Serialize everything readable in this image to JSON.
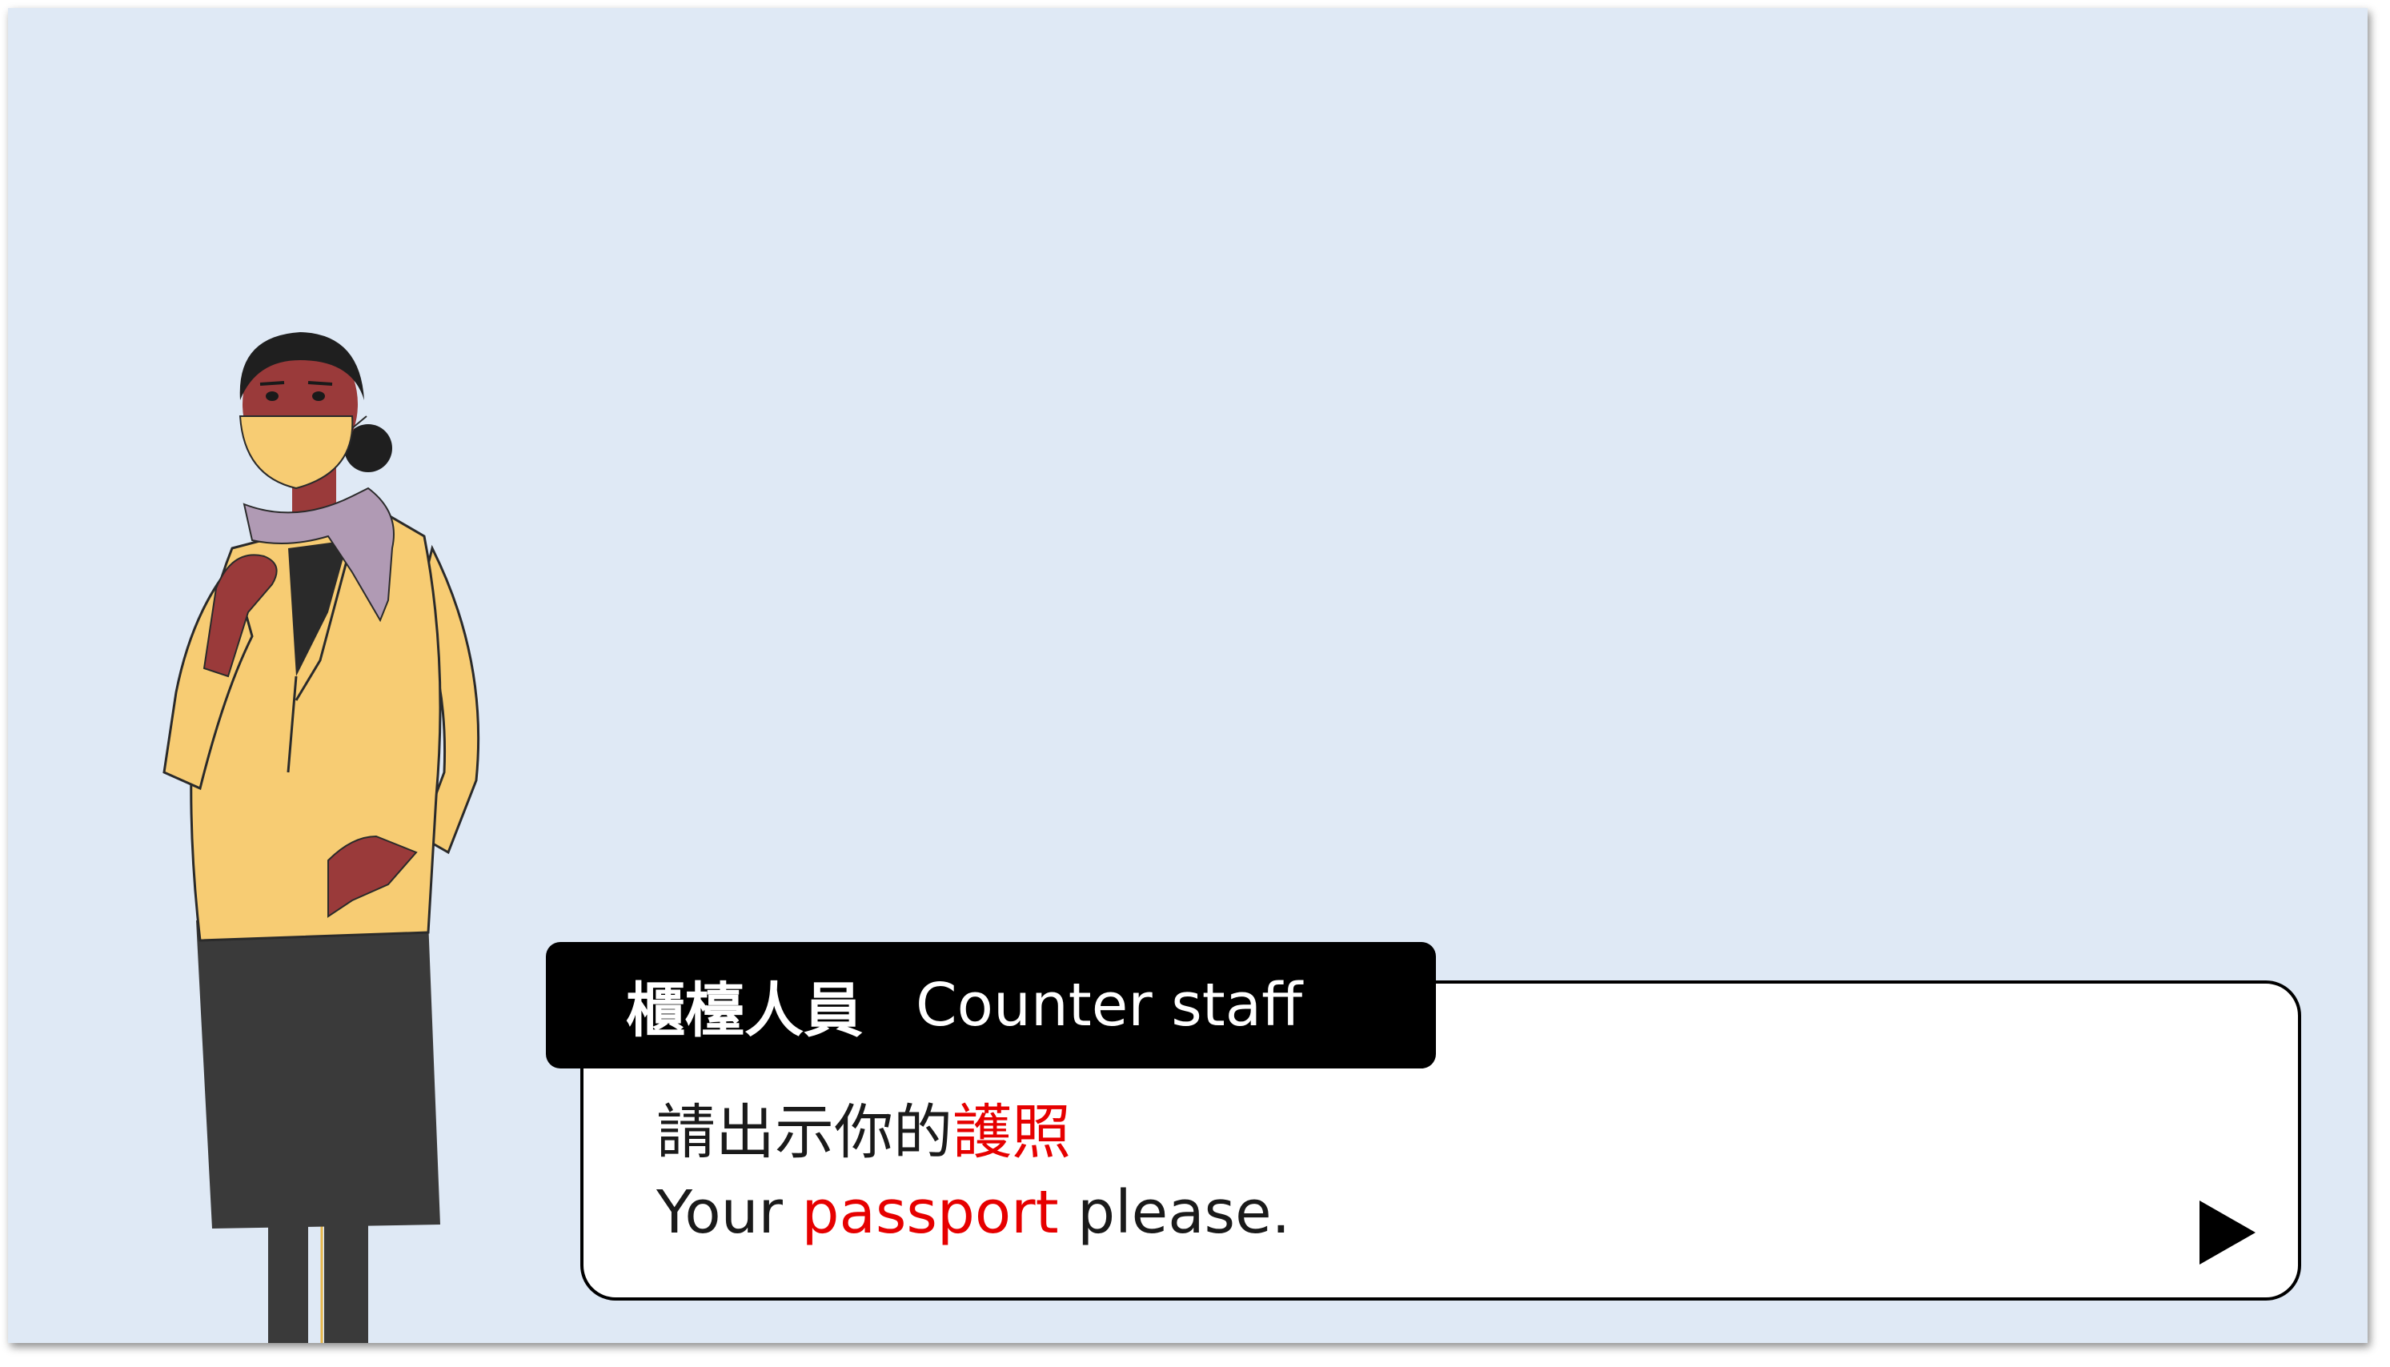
{
  "speaker": {
    "name_zh": "櫃檯人員",
    "name_en": "Counter staff"
  },
  "dialog": {
    "line_zh": {
      "before": "請出示你的",
      "highlight": "護照"
    },
    "line_en": {
      "before": "Your ",
      "highlight": "passport",
      "after": " please."
    }
  },
  "icons": {
    "next": "play-triangle-icon"
  },
  "colors": {
    "background": "#dfe9f5",
    "highlight": "#e60000",
    "tab": "#000000"
  }
}
